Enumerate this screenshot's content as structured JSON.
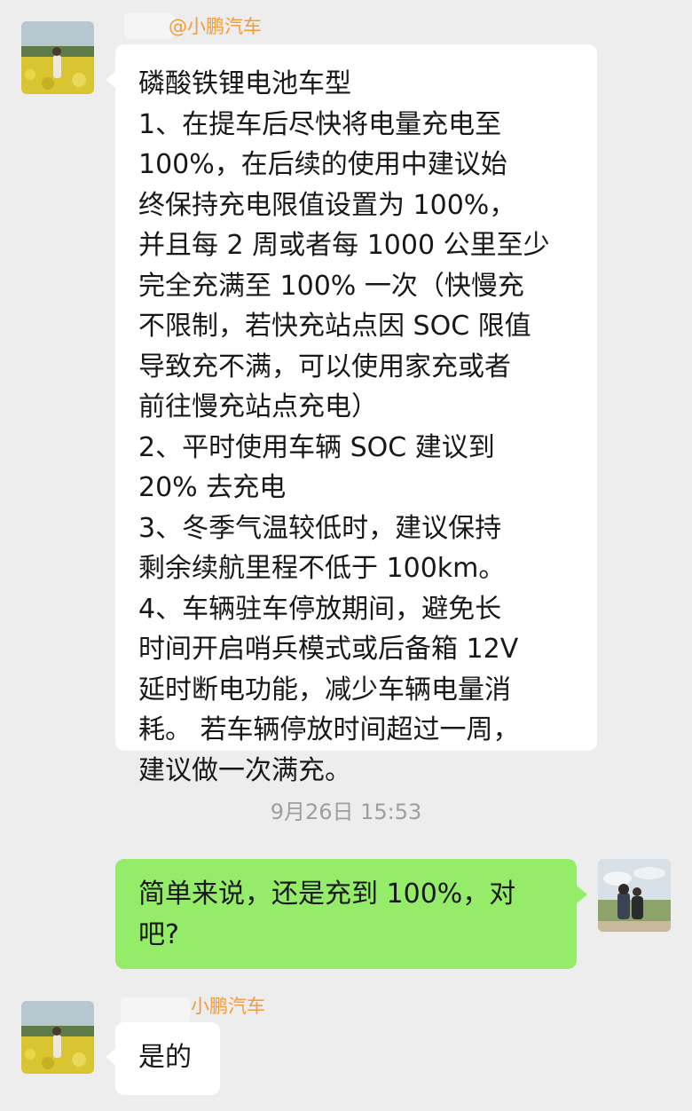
{
  "messages": [
    {
      "sender": "@小鹏汽车",
      "lines": [
        "磷酸铁锂电池车型",
        "1、在提车后尽快将电量充电至",
        "100%，在后续的使用中建议始",
        "终保持充电限值设置为 100%，",
        "并且每 2 周或者每 1000 公里至少",
        "完全充满至 100% 一次（快慢充",
        "不限制，若快充站点因 SOC 限值",
        "导致充不满，可以使用家充或者",
        "前往慢充站点充电）",
        "2、平时使用车辆 SOC 建议到",
        "20% 去充电",
        "3、冬季气温较低时，建议保持",
        "剩余续航里程不低于 100km。",
        "4、车辆驻车停放期间，避免长",
        "时间开启哨兵模式或后备箱 12V",
        "延时断电功能，减少车辆电量消",
        "耗。 若车辆停放时间超过一周，",
        "建议做一次满充。"
      ]
    },
    {
      "timestamp": "9月26日 15:53"
    },
    {
      "lines": [
        "简单来说，还是充到 100%，对",
        "吧?"
      ]
    },
    {
      "sender": "小鹏汽车",
      "lines": [
        "是的"
      ]
    }
  ],
  "colors": {
    "background": "#EDEDED",
    "incoming_bubble": "#FFFFFF",
    "outgoing_bubble": "#95EC69",
    "sender_name": "#F29B38",
    "timestamp": "#9E9E9E"
  }
}
